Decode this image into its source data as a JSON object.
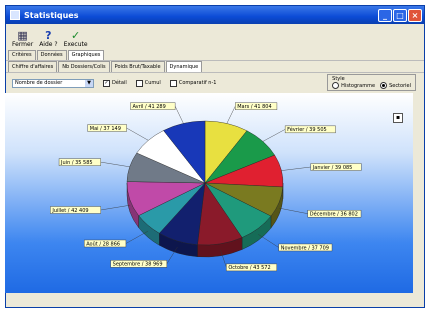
{
  "window": {
    "title": "Statistiques"
  },
  "toolbar": {
    "buttons": [
      {
        "label": "Fermer",
        "icon": "close-folder-icon"
      },
      {
        "label": "Aide ?",
        "icon": "help-icon"
      },
      {
        "label": "Execute",
        "icon": "checkmark-icon"
      }
    ]
  },
  "tabs": [
    "Critères",
    "Données",
    "Graphiques"
  ],
  "active_tab": "Graphiques",
  "subtabs": [
    "Chiffre d'affaires",
    "Nb Dossiers/Colis",
    "Poids Brut/Taxable",
    "Dynamique"
  ],
  "active_subtab": "Dynamique",
  "options": {
    "measure_select": "Nombre de dossier",
    "checkboxes": [
      {
        "label": "Détail",
        "checked": true
      },
      {
        "label": "Cumul",
        "checked": false
      },
      {
        "label": "Comparatif n-1",
        "checked": false
      }
    ],
    "style": {
      "title": "Style",
      "options": [
        {
          "label": "Histogramme",
          "selected": false
        },
        {
          "label": "Sectoriel",
          "selected": true
        }
      ]
    }
  },
  "chart_data": {
    "type": "pie",
    "slices": [
      {
        "label": "Mars / 41 804",
        "value": 41804,
        "color": "#e8e040"
      },
      {
        "label": "Février / 39 505",
        "value": 39505,
        "color": "#1a9a4a"
      },
      {
        "label": "Janvier / 39 085",
        "value": 39085,
        "color": "#e02030"
      },
      {
        "label": "Décembre / 36 802",
        "value": 36802,
        "color": "#7a7a20"
      },
      {
        "label": "Novembre / 37 709",
        "value": 37709,
        "color": "#1f9a7c"
      },
      {
        "label": "Octobre / 43 572",
        "value": 43572,
        "color": "#8a1a2a"
      },
      {
        "label": "Septembre / 38 969",
        "value": 38969,
        "color": "#12206e"
      },
      {
        "label": "Août / 28 866",
        "value": 28866,
        "color": "#2a9aa8"
      },
      {
        "label": "Juillet / 42 409",
        "value": 42409,
        "color": "#c04aa8"
      },
      {
        "label": "Juin / 35 585",
        "value": 35585,
        "color": "#707a88"
      },
      {
        "label": "Mai / 37 149",
        "value": 37149,
        "color": "#ffffff"
      },
      {
        "label": "Avril / 41 289",
        "value": 41289,
        "color": "#1838b8"
      }
    ]
  }
}
